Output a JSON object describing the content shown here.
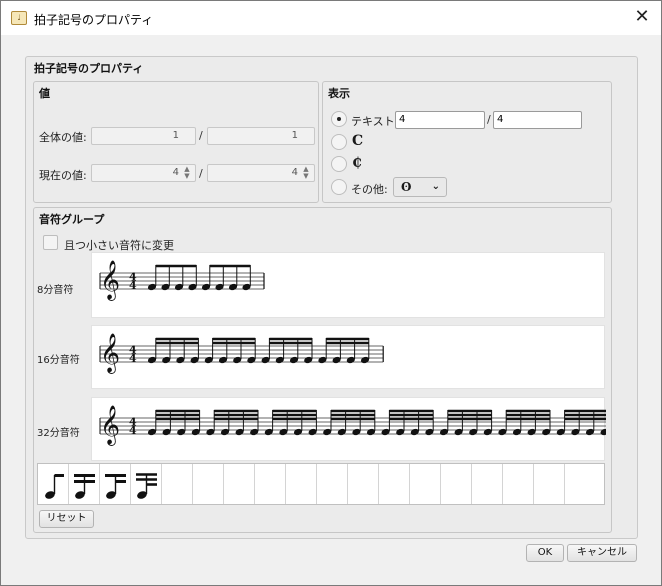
{
  "window": {
    "title": "拍子記号のプロパティ",
    "app_icon_text": "ſ‿Ö",
    "close_glyph": "✕"
  },
  "panel": {
    "title": "拍子記号のプロパティ"
  },
  "value_group": {
    "title": "値",
    "total_label": "全体の値:",
    "total_numerator": "1",
    "total_denominator": "1",
    "current_label": "現在の値:",
    "current_numerator": "4",
    "current_denominator": "4",
    "separator": "/"
  },
  "display_group": {
    "title": "表示",
    "text_option_label": "テキスト:",
    "text_numerator": "4",
    "text_denominator": "4",
    "common_time_symbol": "𝄴",
    "cut_time_symbol": "𝄵",
    "other_label": "その他:",
    "other_selected": "ʘ",
    "selected_option": "text"
  },
  "note_group": {
    "title": "音符グループ",
    "checkbox_label": "且つ小さい音符に変更",
    "checkbox_checked": false,
    "rows": [
      {
        "label": "8分音符",
        "beam_count": 1,
        "notes": 8,
        "groups": 2,
        "group_size": 4
      },
      {
        "label": "16分音符",
        "beam_count": 2,
        "notes": 16,
        "groups": 4,
        "group_size": 4
      },
      {
        "label": "32分音符",
        "beam_count": 3,
        "notes": 32,
        "groups": 8,
        "group_size": 4
      }
    ],
    "time_signature": {
      "numerator": "4",
      "denominator": "4"
    },
    "palette_icons": [
      "eighth-note-icon",
      "sixteenth-note-icon",
      "sixteenth-note-alt-icon",
      "thirty-second-note-icon"
    ],
    "reset_label": "リセット"
  },
  "footer": {
    "ok_label": "OK",
    "cancel_label": "キャンセル"
  }
}
